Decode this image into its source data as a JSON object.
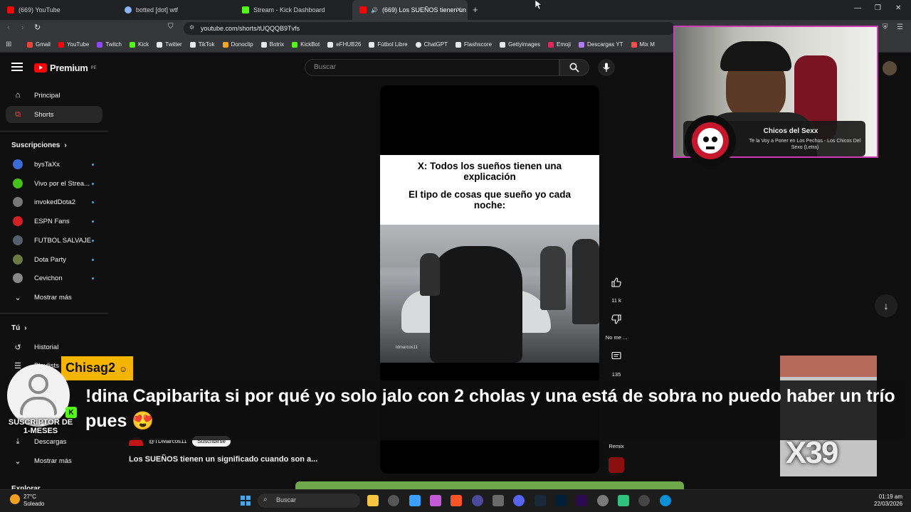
{
  "browser": {
    "tabs": [
      {
        "title": "(669) YouTube",
        "color": "#ff0000"
      },
      {
        "title": "botted [dot] wtf",
        "color": "#8ab4f8"
      },
      {
        "title": "Stream - Kick Dashboard",
        "color": "#53fc18"
      },
      {
        "title": "(669) Los SUEÑOS tienen un",
        "color": "#ff0000"
      }
    ],
    "url": "youtube.com/shorts/tUQQQB9Tvfs",
    "bookmarks": [
      {
        "label": "Gmail",
        "color": "#ea4335"
      },
      {
        "label": "YouTube",
        "color": "#ff0000"
      },
      {
        "label": "Twitch",
        "color": "#9146ff"
      },
      {
        "label": "Kick",
        "color": "#53fc18"
      },
      {
        "label": "Twitter",
        "color": "#e8e8e8"
      },
      {
        "label": "TikTok",
        "color": "#e8e8e8"
      },
      {
        "label": "Donoclip",
        "color": "#f5a623"
      },
      {
        "label": "Botrix",
        "color": "#e8e8e8"
      },
      {
        "label": "KickBot",
        "color": "#53fc18"
      },
      {
        "label": "eFHUB26",
        "color": "#e8e8e8"
      },
      {
        "label": "Fútbol Libre",
        "color": "#e8e8e8"
      },
      {
        "label": "ChatGPT",
        "color": "#e8e8e8"
      },
      {
        "label": "Flashscore",
        "color": "#e8e8e8"
      },
      {
        "label": "Gettyimages",
        "color": "#e8e8e8"
      },
      {
        "label": "Emoji",
        "color": "#e0245e"
      },
      {
        "label": "Descargas YT",
        "color": "#b07cff"
      },
      {
        "label": "Mix M",
        "color": "#ff4c4c"
      }
    ]
  },
  "youtube": {
    "logo": "Premium",
    "logo_region": "PE",
    "search_placeholder": "Buscar",
    "nav": [
      {
        "label": "Principal",
        "icon": "home-icon"
      },
      {
        "label": "Shorts",
        "icon": "shorts-icon"
      }
    ],
    "subscriptions_heading": "Suscripciones",
    "subscriptions": [
      {
        "label": "bysTaXx",
        "color": "#3b6bd6"
      },
      {
        "label": "Vivo por el Strea...",
        "color": "#44c21a"
      },
      {
        "label": "invokedDota2",
        "color": "#777777"
      },
      {
        "label": "ESPN Fans",
        "color": "#d31f26"
      },
      {
        "label": "FUTBOL SALVAJE",
        "color": "#555f6e"
      },
      {
        "label": "Dota Party",
        "color": "#6b7a45"
      },
      {
        "label": "Cevichon",
        "color": "#888888"
      }
    ],
    "show_more": "Mostrar más",
    "you_heading": "Tú",
    "you_items": [
      {
        "label": "Historial",
        "icon": "history-icon"
      },
      {
        "label": "Playlists",
        "icon": "playlists-icon"
      },
      {
        "label": "Descargas",
        "icon": "download-icon"
      }
    ],
    "show_more_2": "Mostrar más",
    "explore_heading": "Explorar",
    "short": {
      "caption_line1": "X: Todos los sueños tienen una explicación",
      "caption_line2": "El tipo de cosas que sueño yo cada noche:",
      "watermark": "tdmarcos11",
      "channel": "@TDMarcos11",
      "subscribe": "Suscribirse",
      "title": "Los SUEÑOS tienen un significado cuando son a..."
    },
    "actions": {
      "likes": "11 k",
      "dislike": "No me ...",
      "comments": "135",
      "remix": "Remix"
    }
  },
  "overlay": {
    "username": "Chisag2",
    "sub_badge_line1": "SUSCRIPTOR DE",
    "sub_badge_line2": "1-MESES",
    "message": "!dina Capibarita si por qué yo solo jalo con 2 cholas y una está de sobra no puedo haber un trío pues 😍",
    "now_playing_title": "Chicos del Sexx",
    "now_playing_subtitle": "Te la Voy a Poner en Los Pechos - Los Chicos Del Sexo (Letra)",
    "multiplier": "X39"
  },
  "taskbar": {
    "weather_temp": "27°C",
    "weather_desc": "Soleado",
    "search": "Buscar",
    "time": "01:19 am",
    "date": "22/03/2026"
  }
}
